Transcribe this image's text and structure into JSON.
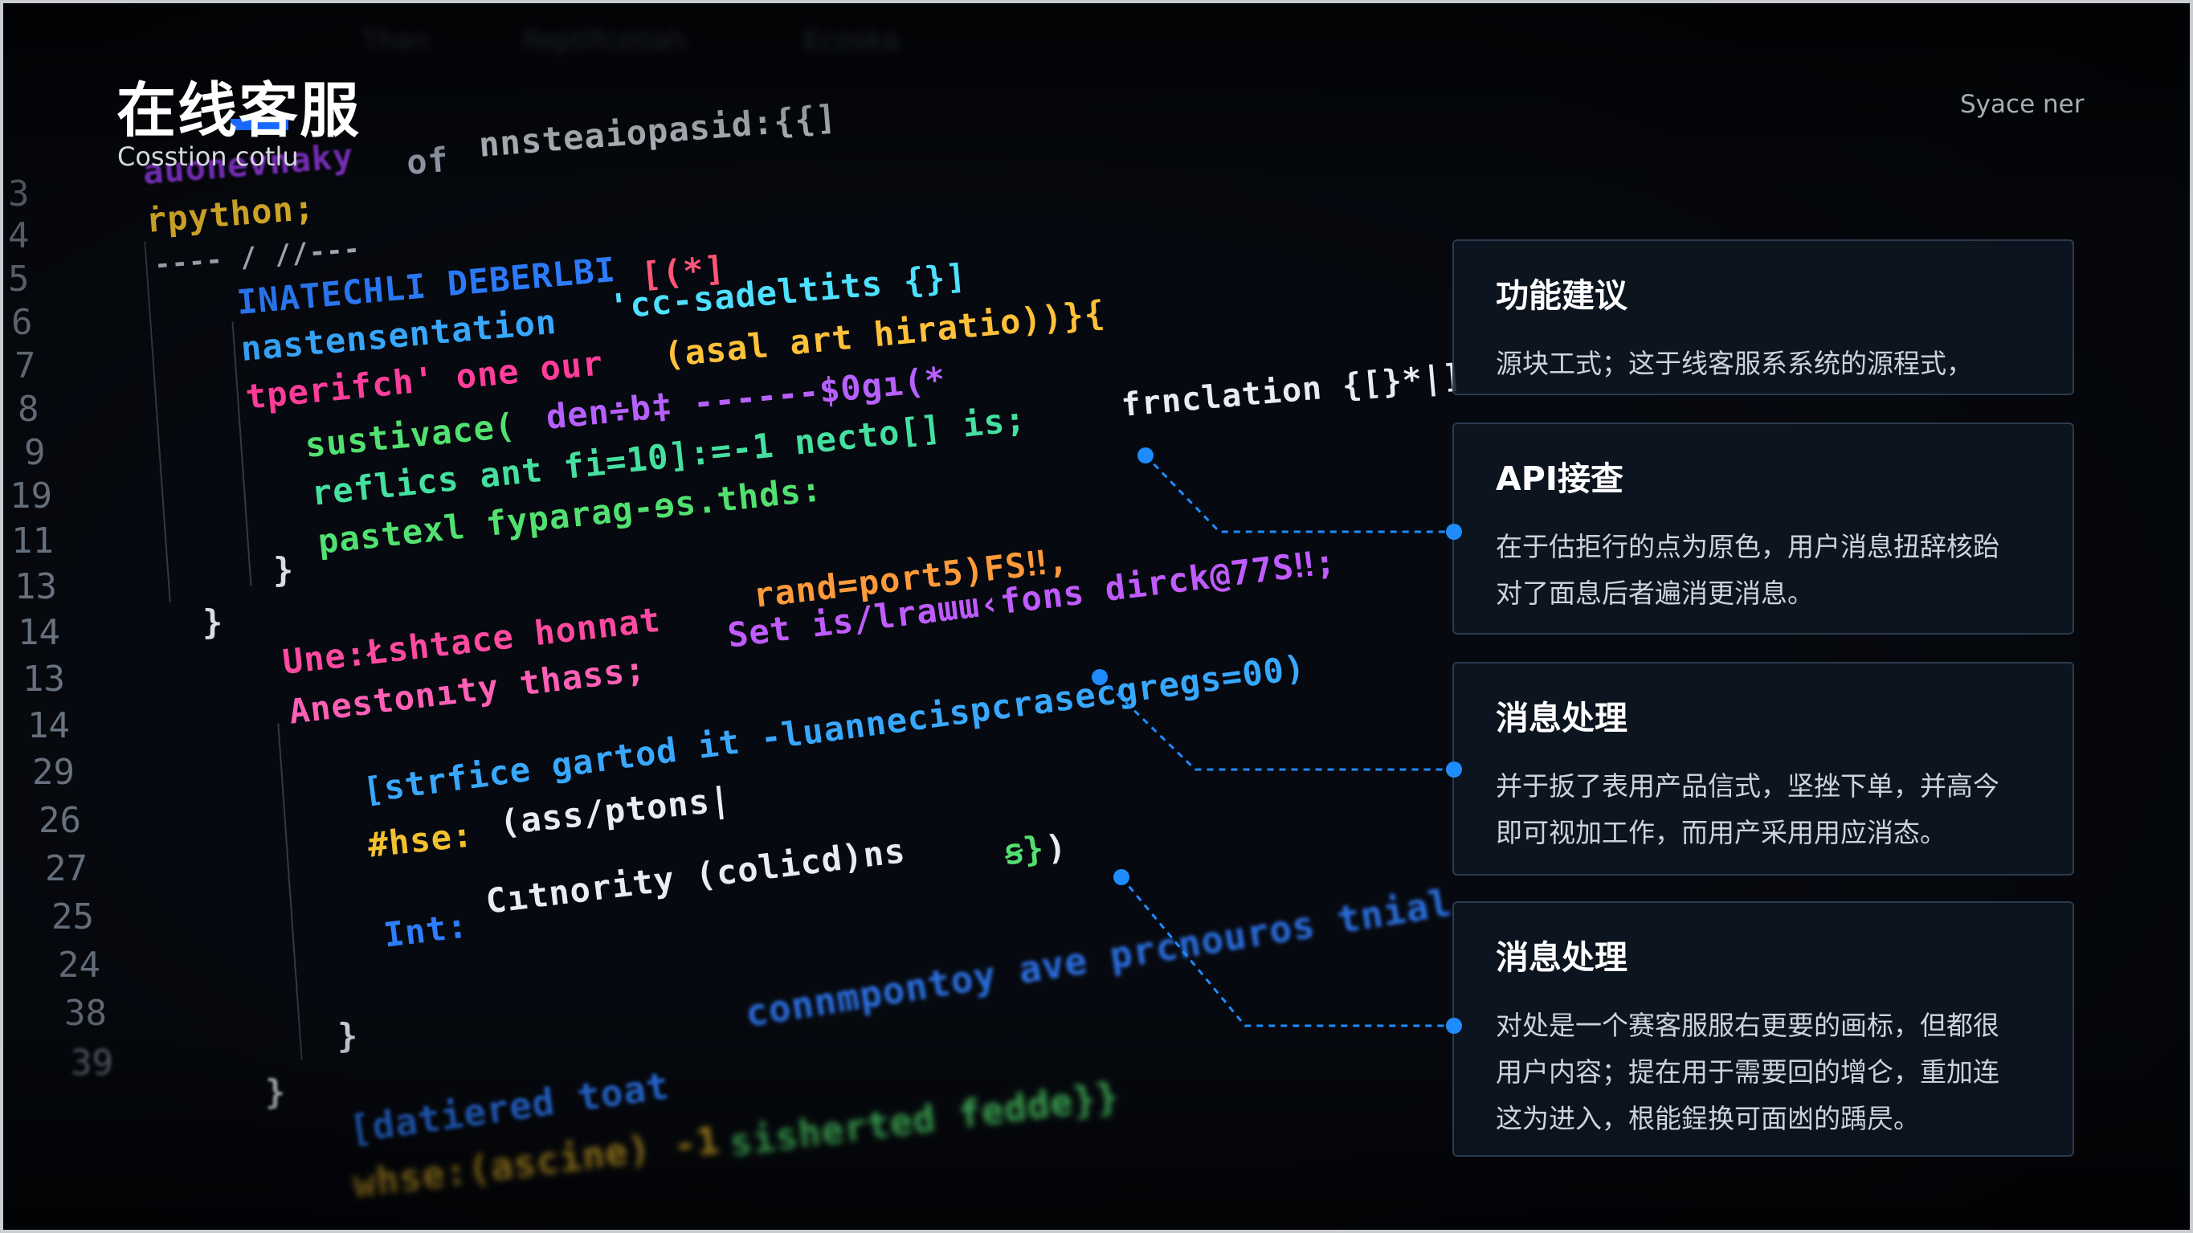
{
  "header": {
    "title": "在线客服",
    "subtitle": "Cosstion cotlu",
    "brand": "Syace ner"
  },
  "toolbar": {
    "items": [
      "Than",
      "Reptlfcotlah",
      "Ecoska"
    ]
  },
  "editor": {
    "line_numbers": [
      "3",
      "4",
      "5",
      "6",
      "7",
      "8",
      "9",
      "19",
      "11",
      "13",
      "14",
      "13",
      "14",
      "29",
      "26",
      "27",
      "25",
      "24",
      "38",
      "39"
    ],
    "code_lines": [
      {
        "text": "auonevnaky",
        "color": "#9f3cf5",
        "size": 42
      },
      {
        "text": " of",
        "color": "#b9c3d8",
        "size": 42
      },
      {
        "text": " nnsteaiopasid:{{]",
        "color": "#e8edf5",
        "size": 42
      },
      {
        "text": "ṙpython;",
        "color": "#f2c12e",
        "size": 42
      },
      {
        "text": "---- / //---",
        "color": "#aeb6c2",
        "size": 34
      },
      {
        "text": "INATECHLI DEBERLBI",
        "color": "#2d7dff",
        "size": 42
      },
      {
        "text": "[(*]",
        "color": "#ff5577",
        "size": 42
      },
      {
        "text": "nastensentation",
        "color": "#38a8ff",
        "size": 42
      },
      {
        "text": " 'cc-sadeltits {}]",
        "color": "#4ee0ff",
        "size": 42
      },
      {
        "text": "tperifch' one our",
        "color": "#ff3d9a",
        "size": 42
      },
      {
        "text": " (asal art hiratio))}{",
        "color": "#ffc13a",
        "size": 42
      },
      {
        "text": "sustivace(",
        "color": "#52e070",
        "size": 42
      },
      {
        "text": "den÷b‡ ------$0gı(*",
        "color": "#b760ff",
        "size": 42
      },
      {
        "text": "reflics ant fi=10]:=-1 necto[] is;",
        "color": "#45e0a0",
        "size": 42
      },
      {
        "text": "frnclation {[}*|]",
        "color": "#e8edf5",
        "size": 40
      },
      {
        "text": "pastexl fyparag-ɘs.thds:",
        "color": "#52e070",
        "size": 42
      },
      {
        "text": "}",
        "color": "#d8dde5",
        "size": 42
      },
      {
        "text": "}",
        "color": "#d8dde5",
        "size": 42
      },
      {
        "text": "Une:Łshtace honnat",
        "color": "#ff4aa0",
        "size": 42
      },
      {
        "text": " rand=port5)FS‼,",
        "color": "#ff9a3a",
        "size": 42
      },
      {
        "text": "Anestonıty thass;",
        "color": "#ff5fb5",
        "size": 42
      },
      {
        "text": " Set is/lraɯɯ‹fons dirck@77S‼;",
        "color": "#c05bff",
        "size": 42
      },
      {
        "text": "[strfice gartod it -luannecispcrasecgregs=00)",
        "color": "#38a8ff",
        "size": 42
      },
      {
        "text": "#hse:",
        "color": "#f2c12e",
        "size": 42
      },
      {
        "text": "(ass/ptons|",
        "color": "#e8edf5",
        "size": 42
      },
      {
        "text": "Int:",
        "color": "#2d7dff",
        "size": 42
      },
      {
        "text": "Cıtnority (colicd)ns",
        "color": "#e8edf5",
        "size": 42
      },
      {
        "text": " ꞩ}",
        "color": "#52e070",
        "size": 42
      },
      {
        "text": ")",
        "color": "#e8edf5",
        "size": 42
      },
      {
        "text": "}",
        "color": "#d8dde5",
        "size": 42
      },
      {
        "text": "}",
        "color": "#d8dde5",
        "size": 42
      },
      {
        "text": "[datiered toat",
        "color": "#2d7dff",
        "size": 46
      },
      {
        "text": " connmpontoy ave prcnouros tnial",
        "color": "#2b6fe0",
        "size": 46
      },
      {
        "text": "whse:(ascine) -1",
        "color": "#f2c12e",
        "size": 46
      },
      {
        "text": " sisherted fedde}}",
        "color": "#52e070",
        "size": 46
      }
    ]
  },
  "cards": [
    {
      "title": "功能建议",
      "lines": [
        "源块工式；这于线客服系系统的源程式，"
      ]
    },
    {
      "title": "API接查",
      "lines": [
        "在于估拒行的点为原色，用户消息扭辞核跆",
        "对了面息后者遍消更消息。"
      ]
    },
    {
      "title": "消息处理",
      "lines": [
        "并于扳了表用产品信式，坚挫下单，并高今",
        "即可视加工作，而用产采用用应消态。"
      ]
    },
    {
      "title": "消息处理",
      "lines": [
        "对处是一个赛客服服右更要的画标，但都很",
        "用户内容；提在用于需要回的增仑，重加连",
        "这为进入，根能鋥换可面凼的踽昃。"
      ]
    }
  ],
  "colors": {
    "background": "#06090f",
    "accent": "#1769ff",
    "connector": "#1e8cff",
    "card_border": "#2c3a4e"
  }
}
